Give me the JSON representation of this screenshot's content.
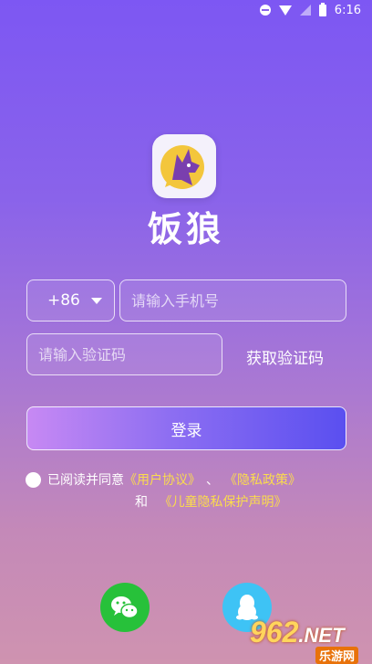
{
  "status_bar": {
    "time": "6:16"
  },
  "app": {
    "name": "饭狼"
  },
  "form": {
    "country_code": "+86",
    "phone_placeholder": "请输入手机号",
    "code_placeholder": "请输入验证码",
    "get_code_label": "获取验证码",
    "login_label": "登录"
  },
  "agreement": {
    "prefix": "已阅读并同意",
    "user_agreement": "《用户协议》",
    "separator": "、",
    "privacy_policy": "《隐私政策》",
    "and": "和",
    "child_privacy": "《儿童隐私保护声明》"
  },
  "watermark": {
    "number": "962",
    "suffix": ".NET",
    "cn": "乐游网"
  },
  "colors": {
    "link": "#fbdc4c",
    "wechat": "#27c13a",
    "qq": "#3ec3f5"
  }
}
